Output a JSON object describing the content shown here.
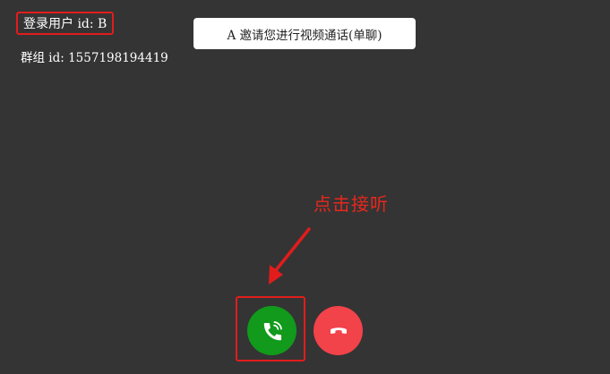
{
  "header": {
    "login_user_label": "登录用户 id: B",
    "group_id_label": "群组 id: 1557198194419"
  },
  "notification": {
    "invite_text": "A 邀请您进行视频通话(单聊)"
  },
  "annotation": {
    "text": "点击接听"
  },
  "call_controls": {
    "accept_icon": "phone-ringing-icon",
    "reject_icon": "hang-up-icon"
  },
  "colors": {
    "background": "#343434",
    "accept": "#119a1b",
    "reject": "#f2424a",
    "annotation": "#e21c1c"
  }
}
